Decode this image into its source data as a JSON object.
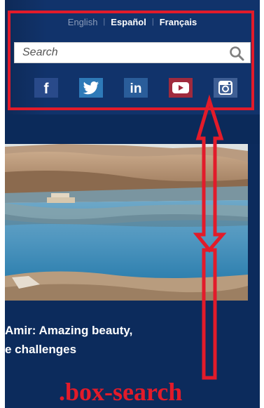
{
  "header": {
    "languages": [
      {
        "label": "English",
        "active": false
      },
      {
        "label": "Español",
        "active": true
      },
      {
        "label": "Français",
        "active": true
      }
    ],
    "language_separator": "|",
    "search": {
      "placeholder": "Search",
      "value": ""
    },
    "social": [
      {
        "network": "facebook",
        "glyph": "f",
        "icon": "facebook-icon"
      },
      {
        "network": "twitter",
        "icon": "twitter-icon"
      },
      {
        "network": "linkedin",
        "glyph": "in",
        "icon": "linkedin-icon"
      },
      {
        "network": "youtube",
        "icon": "youtube-icon"
      },
      {
        "network": "instagram",
        "icon": "instagram-icon"
      }
    ]
  },
  "article": {
    "headline_line1": "Amir: Amazing beauty,",
    "headline_line2": "e challenges"
  },
  "annotation": {
    "label": ".box-search",
    "color": "#e21b2a"
  },
  "colors": {
    "page_background": "#0c2b5c",
    "header_background": "#11336b",
    "annotation": "#e21b2a"
  }
}
